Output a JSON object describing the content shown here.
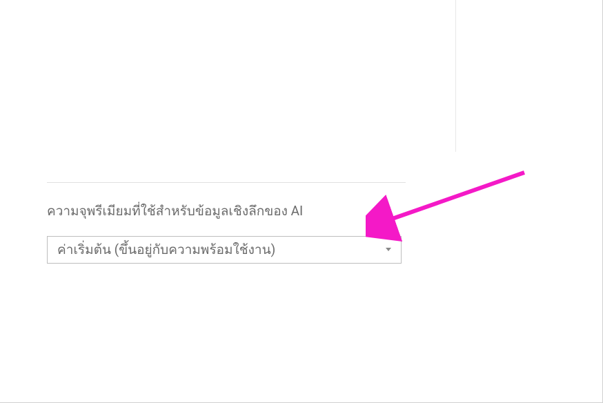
{
  "form": {
    "premium_capacity_label": "ความจุพรีเมียมที่ใช้สำหรับข้อมูลเชิงลึกของ AI",
    "premium_capacity_value": "ค่าเริ่มต้น (ขึ้นอยู่กับความพร้อมใช้งาน)"
  },
  "annotation": {
    "arrow_color": "#f419c7"
  }
}
